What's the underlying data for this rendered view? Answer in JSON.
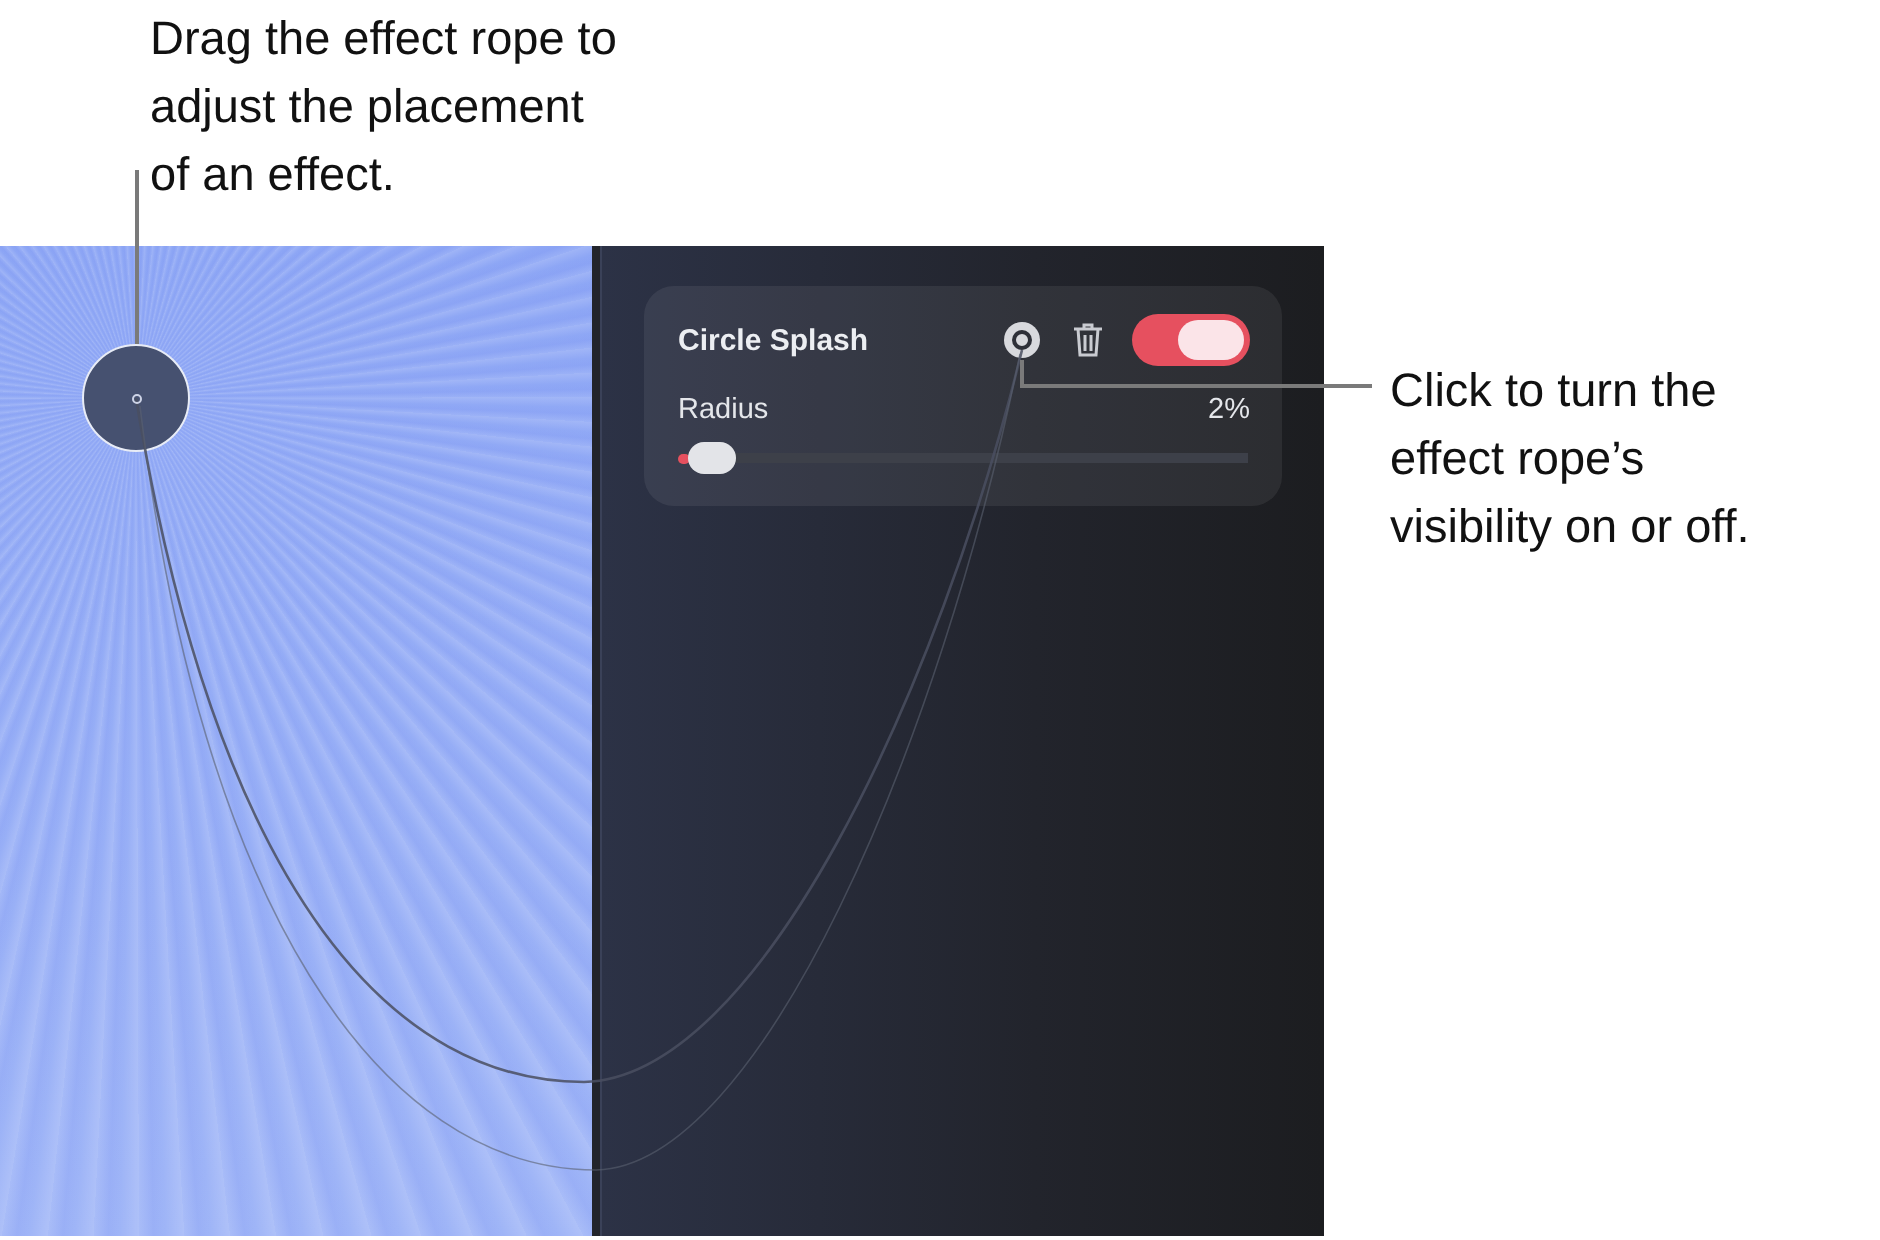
{
  "callouts": [
    {
      "text": "Drag the effect rope to\nadjust the placement\nof an effect."
    },
    {
      "text": "Click to turn the\neffect rope’s\nvisibility on or off."
    }
  ],
  "effect_card": {
    "title": "Circle Splash",
    "rope_visible": true,
    "on": true,
    "slider": {
      "label": "Radius",
      "reading": "2%",
      "level": 0.02
    }
  }
}
